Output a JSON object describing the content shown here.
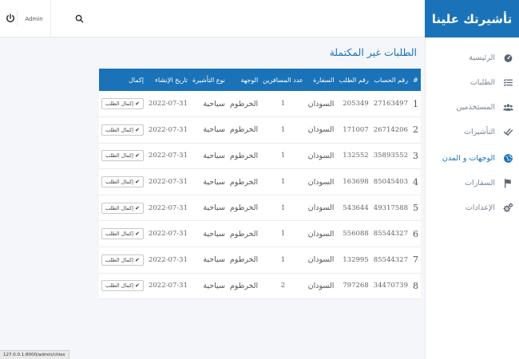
{
  "header": {
    "admin_label": "Admin"
  },
  "brand": {
    "title": "تأشيرتك علينا"
  },
  "sidebar": {
    "items": [
      {
        "label": "الرئيسية",
        "icon": "dashboard-icon"
      },
      {
        "label": "الطلبات",
        "icon": "list-icon"
      },
      {
        "label": "المستخدمين",
        "icon": "users-icon"
      },
      {
        "label": "التأشيرات",
        "icon": "check-icon"
      },
      {
        "label": "الوجهات و المدن",
        "icon": "globe-icon",
        "active": true
      },
      {
        "label": "السفارات",
        "icon": "flag-icon"
      },
      {
        "label": "الإعدادات",
        "icon": "cogs-icon"
      }
    ]
  },
  "main": {
    "title": "الطلبات غير المكتملة",
    "columns": [
      "#",
      "رقم الحساب",
      "رقم الطلب",
      "السفارة",
      "عدد المسافرين",
      "الوجهة",
      "نوع التأشيرة",
      "تاريخ الإنشاء",
      "إكمال"
    ],
    "complete_label": "إكمال الطلب",
    "rows": [
      {
        "index": "1",
        "account": "27163497",
        "order": "205349",
        "embassy": "السودان",
        "travelers": "1",
        "destination": "الخرطوم",
        "visa_type": "سياحية",
        "created": "2022-07-31"
      },
      {
        "index": "2",
        "account": "26714206",
        "order": "171007",
        "embassy": "السودان",
        "travelers": "1",
        "destination": "الخرطوم",
        "visa_type": "سياحية",
        "created": "2022-07-31"
      },
      {
        "index": "3",
        "account": "35893552",
        "order": "132552",
        "embassy": "السودان",
        "travelers": "1",
        "destination": "الخرطوم",
        "visa_type": "سياحية",
        "created": "2022-07-31"
      },
      {
        "index": "4",
        "account": "85045403",
        "order": "163698",
        "embassy": "السودان",
        "travelers": "1",
        "destination": "الخرطوم",
        "visa_type": "سياحية",
        "created": "2022-07-31"
      },
      {
        "index": "5",
        "account": "49317588",
        "order": "543644",
        "embassy": "السودان",
        "travelers": "1",
        "destination": "الخرطوم",
        "visa_type": "سياحية",
        "created": "2022-07-31"
      },
      {
        "index": "6",
        "account": "85544327",
        "order": "556088",
        "embassy": "السودان",
        "travelers": "1",
        "destination": "الخرطوم",
        "visa_type": "سياحية",
        "created": "2022-07-31"
      },
      {
        "index": "7",
        "account": "85544327",
        "order": "132995",
        "embassy": "السودان",
        "travelers": "1",
        "destination": "الخرطوم",
        "visa_type": "سياحية",
        "created": "2022-07-31"
      },
      {
        "index": "8",
        "account": "34470739",
        "order": "797268",
        "embassy": "السودان",
        "travelers": "2",
        "destination": "الخرطوم",
        "visa_type": "سياحية",
        "created": "2022-07-31"
      }
    ]
  },
  "statusbar": {
    "url": "127.0.0.1:8000/admin/cities"
  },
  "colors": {
    "accent": "#1a73b8"
  }
}
